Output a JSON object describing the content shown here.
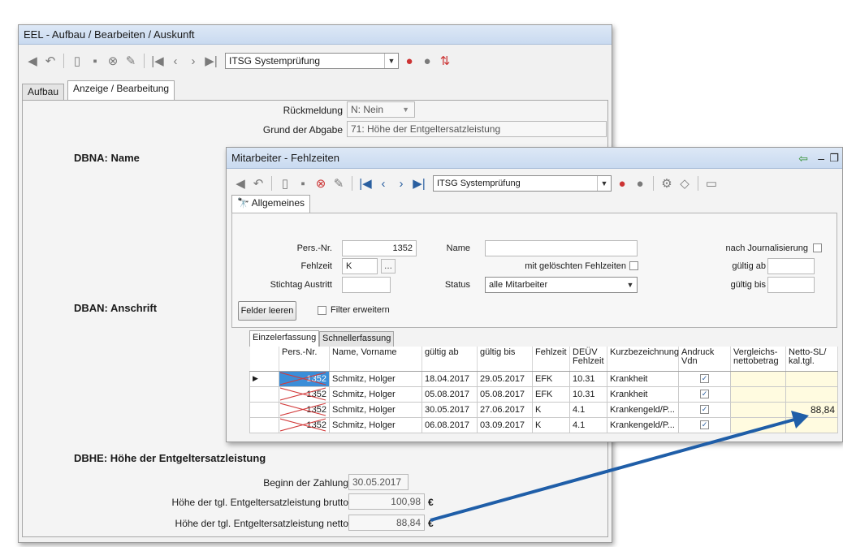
{
  "back_window": {
    "title": "EEL - Aufbau / Bearbeiten / Auskunft",
    "toolbar": {
      "combo_value": "ITSG Systemprüfung"
    },
    "tabs": [
      {
        "label": "Aufbau"
      },
      {
        "label": "Anzeige / Bearbeitung"
      }
    ],
    "fields": {
      "rueckmeldung": {
        "label": "Rückmeldung",
        "value": "N: Nein"
      },
      "grund": {
        "label": "Grund der Abgabe",
        "value": "71: Höhe der Entgeltersatzleistung"
      },
      "beginn": {
        "label": "Beginn der Zahlung",
        "value": "30.05.2017"
      },
      "brutto": {
        "label": "Höhe der tgl. Entgeltersatzleistung brutto",
        "value": "100,98",
        "unit": "€"
      },
      "netto": {
        "label": "Höhe der tgl. Entgeltersatzleistung netto",
        "value": "88,84",
        "unit": "€"
      }
    },
    "sections": {
      "dbna": "DBNA: Name",
      "dban": "DBAN: Anschrift",
      "dbhe": "DBHE: Höhe der Entgeltersatzleistung"
    }
  },
  "front_window": {
    "title": "Mitarbeiter - Fehlzeiten",
    "toolbar": {
      "combo_value": "ITSG Systemprüfung"
    },
    "tab_allgemeines": "Allgemeines",
    "form": {
      "pers_nr": {
        "label": "Pers.-Nr.",
        "value": "1352"
      },
      "fehlzeit": {
        "label": "Fehlzeit",
        "value": "K",
        "button": "..."
      },
      "stichtag": {
        "label": "Stichtag Austritt",
        "value": ""
      },
      "name": {
        "label": "Name",
        "value": ""
      },
      "mit_geloeschten": {
        "label": "mit gelöschten Fehlzeiten"
      },
      "status": {
        "label": "Status",
        "value": "alle Mitarbeiter"
      },
      "nach_journal": {
        "label": "nach Journalisierung"
      },
      "gueltig_ab": {
        "label": "gültig ab",
        "value": ""
      },
      "gueltig_bis": {
        "label": "gültig bis",
        "value": ""
      },
      "felder_leeren": "Felder leeren",
      "filter_erweitern": "Filter erweitern"
    },
    "subtabs": [
      {
        "label": "Einzelerfassung"
      },
      {
        "label": "Schnellerfassung"
      }
    ],
    "table": {
      "headers": [
        "Pers.-Nr.",
        "Name, Vorname",
        "gültig ab",
        "gültig bis",
        "Fehlzeit",
        "DEÜV Fehlzeit",
        "Kurzbezeichnung",
        "Andruck Vdn",
        "Vergleichs-nettobetrag",
        "Netto-SL/ kal.tgl."
      ],
      "rows": [
        {
          "pers": "1352",
          "name": "Schmitz, Holger",
          "ab": "18.04.2017",
          "bis": "29.05.2017",
          "fz": "EFK",
          "deuv": "10.31",
          "kurz": "Krankheit",
          "andruck": true,
          "vgl": "",
          "netto": ""
        },
        {
          "pers": "1352",
          "name": "Schmitz, Holger",
          "ab": "05.08.2017",
          "bis": "05.08.2017",
          "fz": "EFK",
          "deuv": "10.31",
          "kurz": "Krankheit",
          "andruck": true,
          "vgl": "",
          "netto": ""
        },
        {
          "pers": "1352",
          "name": "Schmitz, Holger",
          "ab": "30.05.2017",
          "bis": "27.06.2017",
          "fz": "K",
          "deuv": "4.1",
          "kurz": "Krankengeld/P...",
          "andruck": true,
          "vgl": "",
          "netto": "88,84"
        },
        {
          "pers": "1352",
          "name": "Schmitz, Holger",
          "ab": "06.08.2017",
          "bis": "03.09.2017",
          "fz": "K",
          "deuv": "4.1",
          "kurz": "Krankengeld/P...",
          "andruck": true,
          "vgl": "",
          "netto": ""
        }
      ]
    }
  },
  "colors": {
    "arrow": "#1f5ea8",
    "title_bar": "#c9daf0",
    "selection": "#3b8ed8"
  }
}
